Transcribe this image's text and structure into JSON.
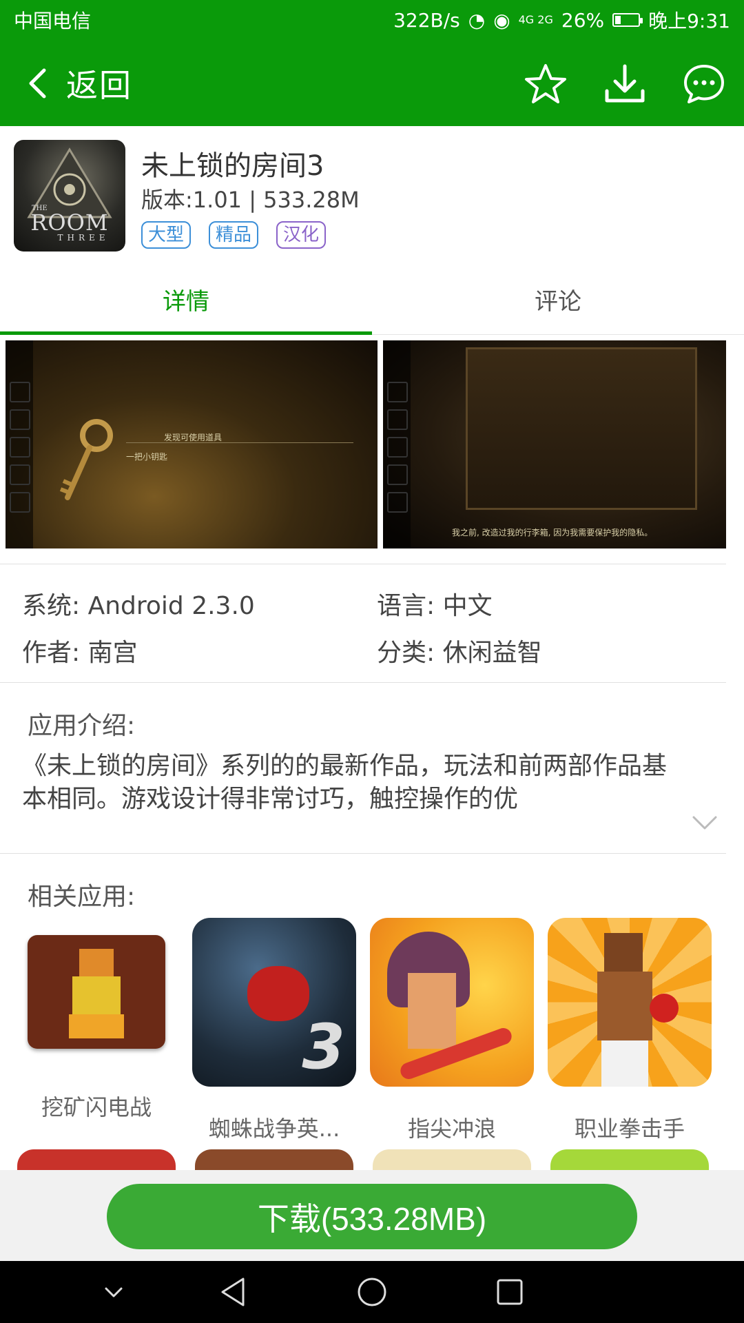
{
  "status_bar": {
    "carrier": "中国电信",
    "net_speed": "322B/s",
    "network": "4G 2G",
    "battery": "26%",
    "battery_level": 0.26,
    "time": "晚上9:31"
  },
  "header": {
    "back_label": "返回",
    "icons": [
      "star-icon",
      "download-icon",
      "message-icon"
    ]
  },
  "app": {
    "name": "未上锁的房间3",
    "meta": "版本:1.01 | 533.28M",
    "icon_text": [
      "THE",
      "ROOM",
      "THREE"
    ],
    "tags": [
      {
        "label": "大型",
        "color": "#3c8fd8"
      },
      {
        "label": "精品",
        "color": "#3c8fd8"
      },
      {
        "label": "汉化",
        "color": "#8a63c9"
      }
    ]
  },
  "tabs": [
    {
      "label": "详情",
      "active": true
    },
    {
      "label": "评论",
      "active": false
    }
  ],
  "screenshots": [
    {
      "caption_top": "发现可使用道具",
      "caption_item": "一把小钥匙"
    },
    {
      "caption_bottom": "我之前, 改造过我的行李箱, 因为我需要保护我的隐私。"
    }
  ],
  "info": {
    "system": "系统: Android 2.3.0",
    "language": "语言: 中文",
    "author": "作者: 南宫",
    "category": "分类: 休闲益智"
  },
  "description": {
    "title": "应用介绍:",
    "text": "《未上锁的房间》系列的的最新作品，玩法和前两部作品基本相同。游戏设计得非常讨巧，触控操作的优"
  },
  "related": {
    "title": "相关应用:",
    "items": [
      {
        "name": "挖矿闪电战"
      },
      {
        "name": "蜘蛛战争英..."
      },
      {
        "name": "指尖冲浪"
      },
      {
        "name": "职业拳击手"
      }
    ]
  },
  "download": {
    "label": "下载(533.28MB)"
  },
  "colors": {
    "brand_green": "#0a9a0a",
    "button_green": "#3aaa35"
  }
}
